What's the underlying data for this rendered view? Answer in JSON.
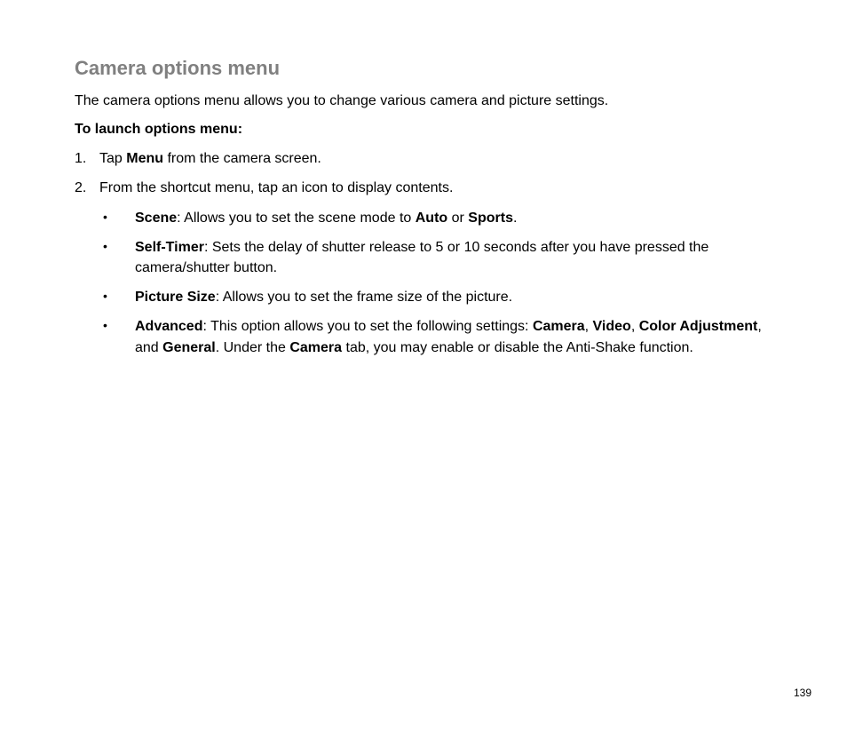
{
  "title": "Camera options menu",
  "intro": "The camera options menu allows you to change various camera and picture settings.",
  "subhead": "To launch options menu:",
  "steps": {
    "s1_num": "1.",
    "s1_tap": "Tap ",
    "s1_menu": "Menu",
    "s1_rest": " from the camera screen.",
    "s2_num": "2.",
    "s2_text": "From the shortcut menu, tap an icon to display contents."
  },
  "bullets": {
    "scene_label": "Scene",
    "scene_text1": ": Allows you to set the scene mode to ",
    "scene_auto": "Auto",
    "scene_or": " or ",
    "scene_sports": "Sports",
    "scene_end": ".",
    "timer_label": "Self-Timer",
    "timer_text": ": Sets the delay of shutter release to 5 or 10 seconds after you have pressed the camera/shutter button.",
    "psize_label": "Picture Size",
    "psize_text": ": Allows you to set the frame size of the picture.",
    "adv_label": "Advanced",
    "adv_t1": ": This option allows you to set the following settings: ",
    "adv_camera": "Camera",
    "adv_c1": ", ",
    "adv_video": "Video",
    "adv_c2": ", ",
    "adv_color": "Color Adjustment",
    "adv_c3": ", and ",
    "adv_general": "General",
    "adv_t2": ". Under the ",
    "adv_camera2": "Camera",
    "adv_t3": " tab, you may enable or disable the Anti-Shake function."
  },
  "page_number": "139"
}
